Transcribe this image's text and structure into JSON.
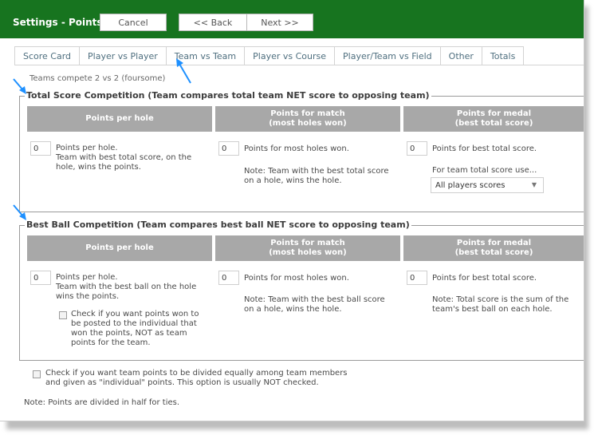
{
  "window": {
    "title": "Settings - Points",
    "buttons": {
      "cancel": "Cancel",
      "back": "<< Back",
      "next": "Next >>"
    }
  },
  "tabs": [
    "Score Card",
    "Player vs Player",
    "Team vs Team",
    "Player vs Course",
    "Player/Team vs Field",
    "Other",
    "Totals"
  ],
  "active_tab": "Team vs Team",
  "intro_text": "Teams compete 2 vs 2 (foursome)",
  "total_score": {
    "legend": "Total Score Competition (Team compares total team NET score to opposing team)",
    "headers": {
      "per_hole": "Points per hole",
      "match_line1": "Points for match",
      "match_line2": "(most holes won)",
      "medal_line1": "Points for medal",
      "medal_line2": "(best total score)"
    },
    "per_hole": {
      "value": "0",
      "label_line1": "Points per hole.",
      "label_line2": "Team with best total score, on the",
      "label_line3": "hole, wins the points."
    },
    "match": {
      "value": "0",
      "label": "Points for most holes won.",
      "note_line1": "Note: Team with the best total score",
      "note_line2": "on a hole, wins the hole."
    },
    "medal": {
      "value": "0",
      "label": "Points for best total score.",
      "use_label": "For team total score use...",
      "select_value": "All players scores"
    }
  },
  "best_ball": {
    "legend": "Best Ball Competition (Team compares best ball NET score to opposing team)",
    "headers": {
      "per_hole": "Points per hole",
      "match_line1": "Points for match",
      "match_line2": "(most holes won)",
      "medal_line1": "Points for medal",
      "medal_line2": "(best total score)"
    },
    "per_hole": {
      "value": "0",
      "label_line1": "Points per hole.",
      "label_line2": "Team with the best ball on the hole",
      "label_line3": "wins the points.",
      "check_line1": "Check if you want points won to",
      "check_line2": "be posted to the individual that",
      "check_line3": "won the points, NOT as team",
      "check_line4": "points for the team."
    },
    "match": {
      "value": "0",
      "label": "Points for most holes won.",
      "note_line1": "Note: Team with the best ball score",
      "note_line2": "on a hole, wins the hole."
    },
    "medal": {
      "value": "0",
      "label": "Points for best total score.",
      "note_line1": "Note: Total score is the sum of the",
      "note_line2": "team's best ball on each hole."
    }
  },
  "divide_check_line1": "Check if you want team points to be divided equally among team members",
  "divide_check_line2": "and given as \"individual\" points. This option is usually NOT checked.",
  "footer_note": "Note: Points are divided in half for ties.",
  "colors": {
    "topbar": "#17741f",
    "header_cell": "#a8a8a8",
    "annotation_arrow": "#1e90ff"
  }
}
